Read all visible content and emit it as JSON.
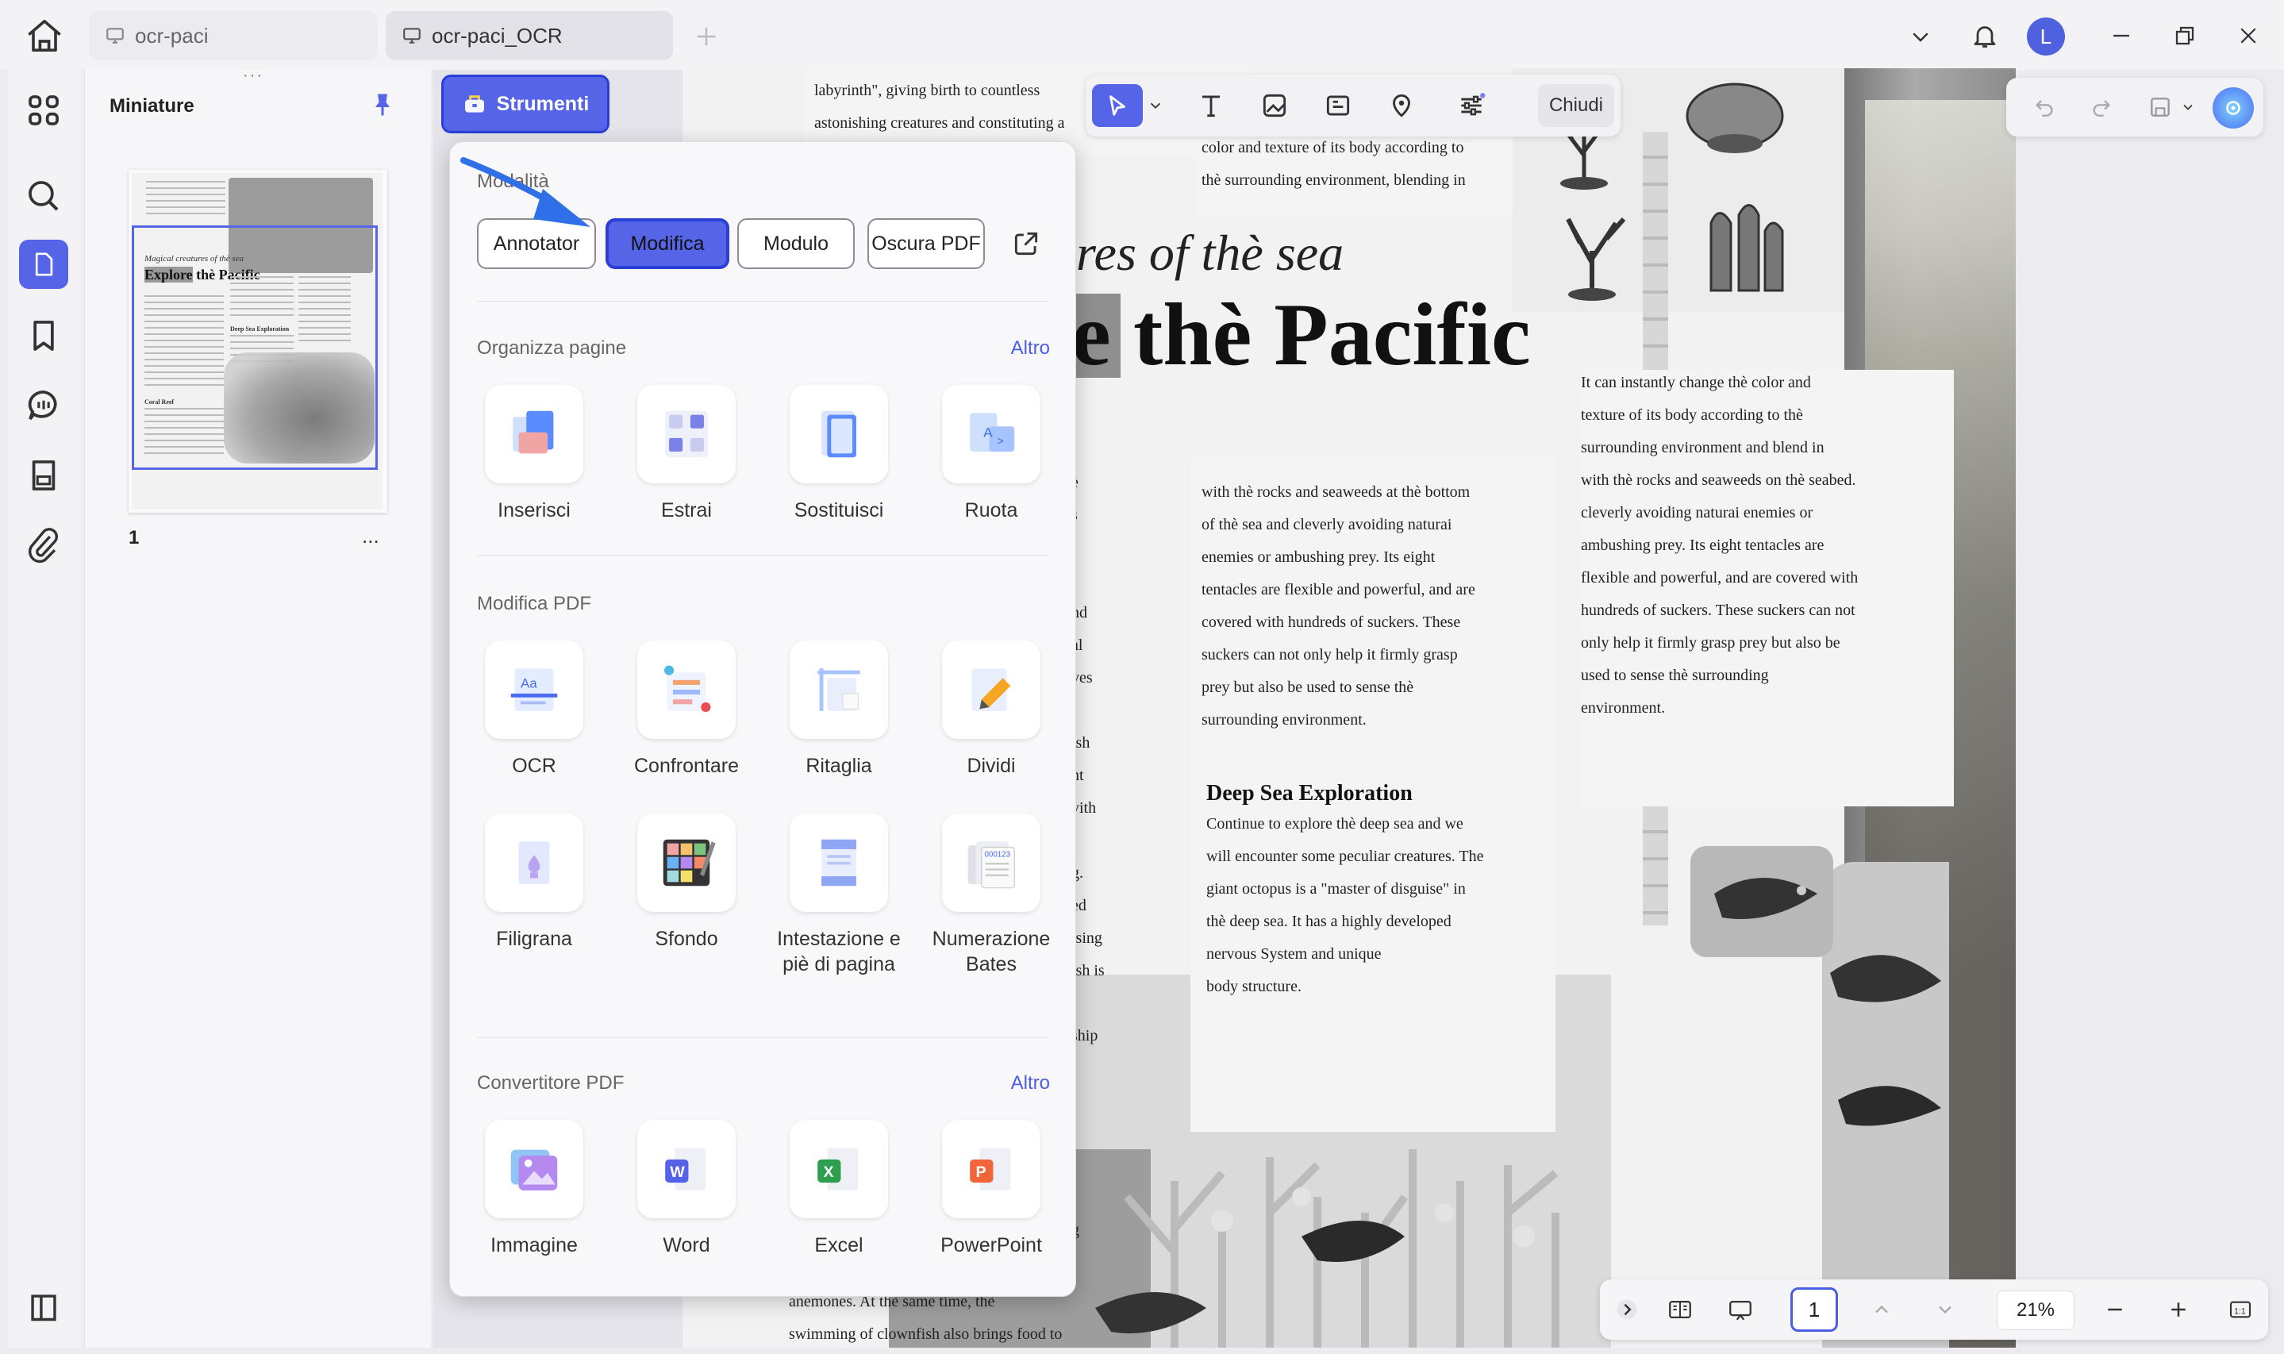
{
  "tabs": [
    {
      "label": "ocr-paci",
      "active": false
    },
    {
      "label": "ocr-paci_OCR",
      "active": true
    }
  ],
  "window": {
    "user_initial": "L"
  },
  "thumbnail_panel": {
    "title": "Miniature",
    "page_number": "1",
    "more": "..."
  },
  "strumenti_button": {
    "label": "Strumenti"
  },
  "dropdown": {
    "mode_section": "Modalità",
    "modes": [
      "Annotator",
      "Modifica",
      "Modulo",
      "Oscura PDF"
    ],
    "active_mode": "Modifica",
    "sections": [
      {
        "title": "Organizza pagine",
        "more": "Altro",
        "tools": [
          "Inserisci",
          "Estrai",
          "Sostituisci",
          "Ruota"
        ]
      },
      {
        "title": "Modifica PDF",
        "more": "",
        "tools": [
          "OCR",
          "Confrontare",
          "Ritaglia",
          "Dividi",
          "Filigrana",
          "Sfondo",
          "Intestazione e piè di pagina",
          "Numerazione Bates"
        ]
      },
      {
        "title": "Convertitore PDF",
        "more": "Altro",
        "tools": [
          "Immagine",
          "Word",
          "Excel",
          "PowerPoint"
        ]
      }
    ]
  },
  "toolbar": {
    "close_label": "Chiudi"
  },
  "bottom_bar": {
    "page": "1",
    "zoom": "21%"
  },
  "document": {
    "heading_italic": "ures of thè sea",
    "heading_big_partial": "e",
    "heading_big": "thè Pacific",
    "top_left_lines": "labyrinth\", giving birth to countless\nastonishing creatures and constituting a",
    "top_mid_lines": "color and texture of its body according to\nthè surrounding environment, blending in",
    "col_mid": "with thè rocks and seaweeds at thè bottom\nof thè sea and cleverly avoiding naturai\nenemies or ambushing prey. Its eight\ntentacles are flexible and powerful, and are\ncovered with hundreds of suckers. These\nsuckers can not only help it firmly grasp\nprey but also be used to sense thè\nsurrounding environment.",
    "col_right": "It can instantly change thè color and\ntexture of its body according to thè\nsurrounding environment and blend in\nwith thè rocks and seaweeds on thè seabed.\ncleverly avoiding naturai enemies or\nambushing prey. Its eight tentacles are\nflexible and powerful, and are covered with\nhundreds of suckers. These suckers can not\nonly help it firmly grasp prey but also be\nused to sense thè surrounding\nenvironment.",
    "deep_title": "Deep Sea Exploration",
    "deep_text": "Continue to explore thè deep sea and we\nwill encounter some peculiar creatures. The\ngiant octopus is a \"master of disguise\" in\nthè deep sea. It has a highly developed\nnervous System and unique\nbody structure.",
    "left_fragments": "è\ns\n\n\nnd\nal\nves\n\nish\nnt\nvith\n\ng.\ned\nising\nish is\n\nship",
    "bottom_lines": "anemones. At thè same time, thè\nswimming of clownfish also brings food to",
    "bottom_frag_g": "g"
  },
  "thumbnail_page": {
    "italic": "Magical creatures of thè sea",
    "explore": "Explore",
    "pacific": "thè Pacific",
    "sub1": "Deep Sea Exploration",
    "sub2": "Coral Reef"
  }
}
